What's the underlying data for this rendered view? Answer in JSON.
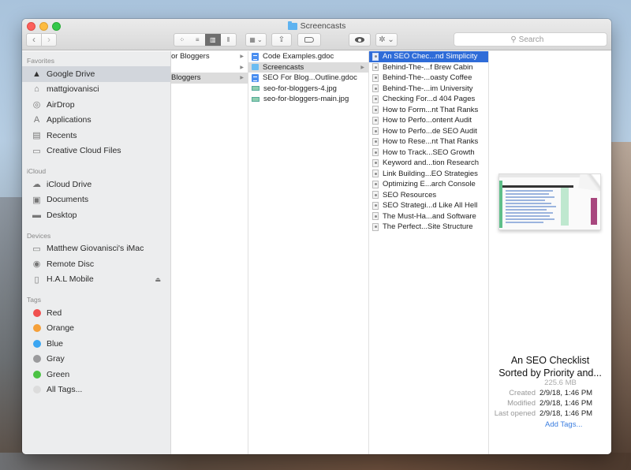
{
  "window": {
    "title": "Screencasts"
  },
  "toolbar": {
    "back": "‹",
    "forward": "›",
    "view_modes": [
      {
        "name": "icon-view",
        "glyph": "⁘",
        "active": false
      },
      {
        "name": "list-view",
        "glyph": "≡",
        "active": false
      },
      {
        "name": "column-view",
        "glyph": "▥",
        "active": true
      },
      {
        "name": "cover-flow-view",
        "glyph": "⫴",
        "active": false
      }
    ],
    "arrange_glyph": "▦ ⌄",
    "share_glyph": "⇪",
    "action_glyph": "✲ ⌄",
    "search_placeholder": "Search",
    "search_icon": "⚲"
  },
  "sidebar": {
    "sections": {
      "favorites": {
        "label": "Favorites",
        "items": [
          {
            "label": "Google Drive",
            "icon": "google-drive-icon",
            "glyph": "▲",
            "selected": true
          },
          {
            "label": "mattgiovanisci",
            "icon": "home-icon",
            "glyph": "⌂"
          },
          {
            "label": "AirDrop",
            "icon": "airdrop-icon",
            "glyph": "◎"
          },
          {
            "label": "Applications",
            "icon": "applications-icon",
            "glyph": "A"
          },
          {
            "label": "Recents",
            "icon": "recents-icon",
            "glyph": "▤"
          },
          {
            "label": "Creative Cloud Files",
            "icon": "folder-icon",
            "glyph": "▭"
          }
        ]
      },
      "icloud": {
        "label": "iCloud",
        "items": [
          {
            "label": "iCloud Drive",
            "icon": "cloud-icon",
            "glyph": "☁"
          },
          {
            "label": "Documents",
            "icon": "documents-icon",
            "glyph": "▣"
          },
          {
            "label": "Desktop",
            "icon": "desktop-icon",
            "glyph": "▬"
          }
        ]
      },
      "devices": {
        "label": "Devices",
        "items": [
          {
            "label": "Matthew Giovanisci's iMac",
            "icon": "imac-icon",
            "glyph": "▭"
          },
          {
            "label": "Remote Disc",
            "icon": "disc-icon",
            "glyph": "◉"
          },
          {
            "label": "H.A.L Mobile",
            "icon": "drive-icon",
            "glyph": "▯",
            "eject": "⏏"
          }
        ]
      },
      "tags": {
        "label": "Tags",
        "items": [
          {
            "label": "Red",
            "color": "#f0504f"
          },
          {
            "label": "Orange",
            "color": "#f5a03a"
          },
          {
            "label": "Blue",
            "color": "#3ba6f2"
          },
          {
            "label": "Gray",
            "color": "#9a9a9c"
          },
          {
            "label": "Green",
            "color": "#4bc243"
          },
          {
            "label": "All Tags...",
            "color": "#dcdcdc"
          }
        ]
      }
    }
  },
  "columns": {
    "col1": [
      {
        "label": "or Bloggers",
        "arrow": "▶",
        "state": ""
      },
      {
        "label": "",
        "arrow": "▶",
        "state": ""
      },
      {
        "label": "Bloggers",
        "arrow": "▶",
        "state": "hl"
      }
    ],
    "col2": [
      {
        "label": "Code Examples.gdoc",
        "type": "gdoc"
      },
      {
        "label": "Screencasts",
        "type": "folder",
        "arrow": "▶",
        "state": "hl"
      },
      {
        "label": "SEO For Blog...Outline.gdoc",
        "type": "gdoc"
      },
      {
        "label": "seo-for-bloggers-4.jpg",
        "type": "jpg"
      },
      {
        "label": "seo-for-bloggers-main.jpg",
        "type": "jpg"
      }
    ],
    "col3": [
      {
        "label": "An SEO Chec...nd Simplicity",
        "state": "sel"
      },
      {
        "label": "Behind-The-...f Brew Cabin"
      },
      {
        "label": "Behind-The-...oasty Coffee"
      },
      {
        "label": "Behind-The-...im University"
      },
      {
        "label": "Checking For...d 404 Pages"
      },
      {
        "label": "How to Form...nt That Ranks"
      },
      {
        "label": "How to Perfo...ontent Audit"
      },
      {
        "label": "How to Perfo...de SEO Audit"
      },
      {
        "label": "How to Rese...nt That Ranks"
      },
      {
        "label": "How to Track...SEO Growth"
      },
      {
        "label": "Keyword and...tion Research"
      },
      {
        "label": "Link Building...EO Strategies"
      },
      {
        "label": "Optimizing E...arch Console"
      },
      {
        "label": "SEO Resources"
      },
      {
        "label": "SEO Strategi...d Like All Hell"
      },
      {
        "label": "The Must-Ha...and Software"
      },
      {
        "label": "The Perfect...Site Structure"
      }
    ]
  },
  "preview": {
    "name_line1": "An SEO Checklist",
    "name_line2": "Sorted by Priority and...",
    "size": "225.6 MB",
    "meta": [
      {
        "key": "Created",
        "value": "2/9/18, 1:46 PM"
      },
      {
        "key": "Modified",
        "value": "2/9/18, 1:46 PM"
      },
      {
        "key": "Last opened",
        "value": "2/9/18, 1:46 PM"
      }
    ],
    "add_tags": "Add Tags..."
  }
}
